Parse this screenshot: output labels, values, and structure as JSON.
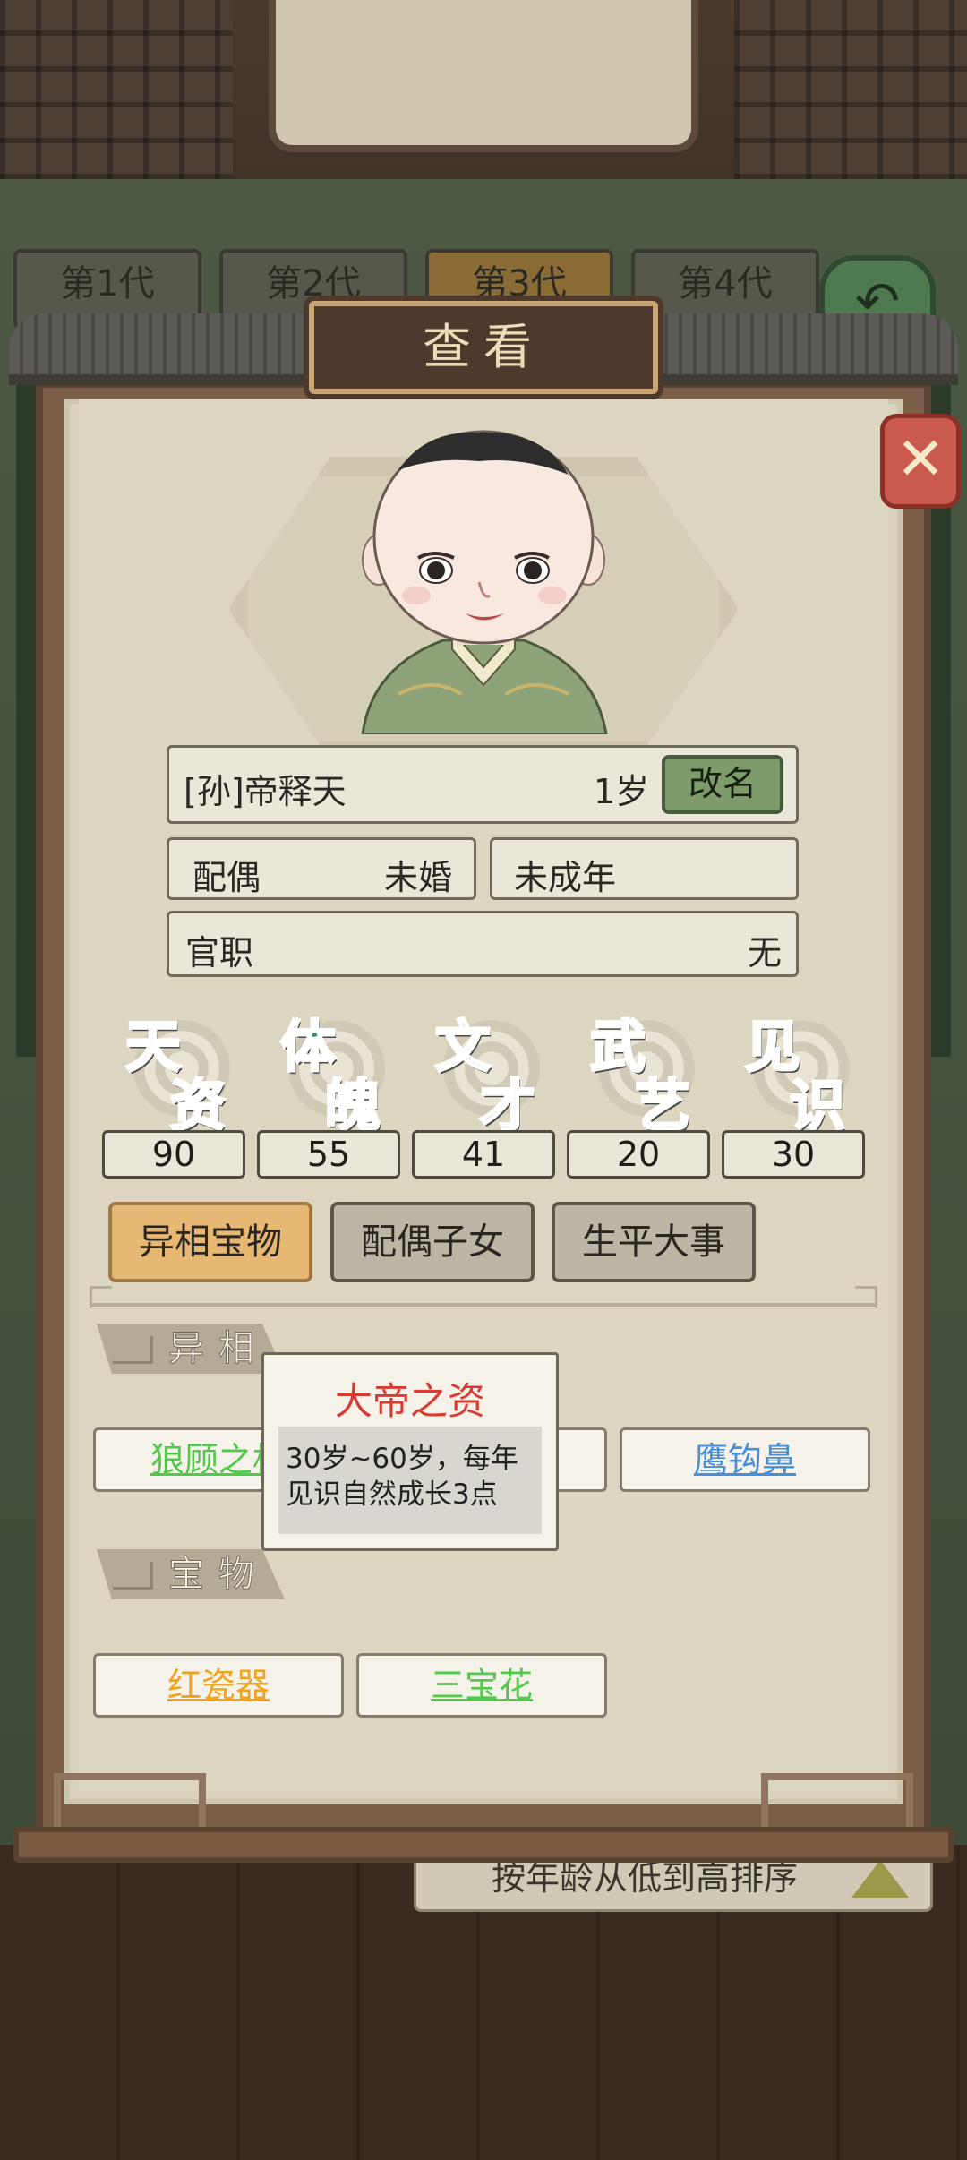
{
  "background": {
    "generation_tabs": [
      "第1代",
      "第2代",
      "第3代",
      "第4代"
    ],
    "active_generation_tab": 2,
    "sort_label": "按年龄从低到高排序"
  },
  "dialog": {
    "title": "查看",
    "close_icon": "close-x-icon"
  },
  "character": {
    "name": "[孙]帝释天",
    "age": "1岁",
    "rename_label": "改名",
    "spouse_label": "配偶",
    "spouse_value": "未婚",
    "status": "未成年",
    "office_label": "官职",
    "office_value": "无"
  },
  "attributes": [
    {
      "c1": "天",
      "c2": "资",
      "value": "90",
      "color": "#3f6fe0"
    },
    {
      "c1": "体",
      "c2": "魄",
      "value": "55",
      "color": "#2f9a62"
    },
    {
      "c1": "文",
      "c2": "才",
      "value": "41",
      "color": "#a456d6"
    },
    {
      "c1": "武",
      "c2": "艺",
      "value": "20",
      "color": "#e0a030"
    },
    {
      "c1": "见",
      "c2": "识",
      "value": "30",
      "color": "#e06a5a"
    }
  ],
  "tabs": [
    "异相宝物",
    "配偶子女",
    "生平大事"
  ],
  "active_tab": 0,
  "sections": {
    "traits_title": "异相",
    "traits": [
      {
        "label": "狼顾之相",
        "color": "green"
      },
      {
        "label": "大帝之资",
        "color": "red"
      },
      {
        "label": "鹰钩鼻",
        "color": "blue"
      }
    ],
    "treasures_title": "宝物",
    "treasures": [
      {
        "label": "红瓷器",
        "color": "orange"
      },
      {
        "label": "三宝花",
        "color": "green"
      }
    ]
  },
  "tooltip": {
    "title": "大帝之资",
    "body": "30岁~60岁，每年见识自然成长3点"
  }
}
